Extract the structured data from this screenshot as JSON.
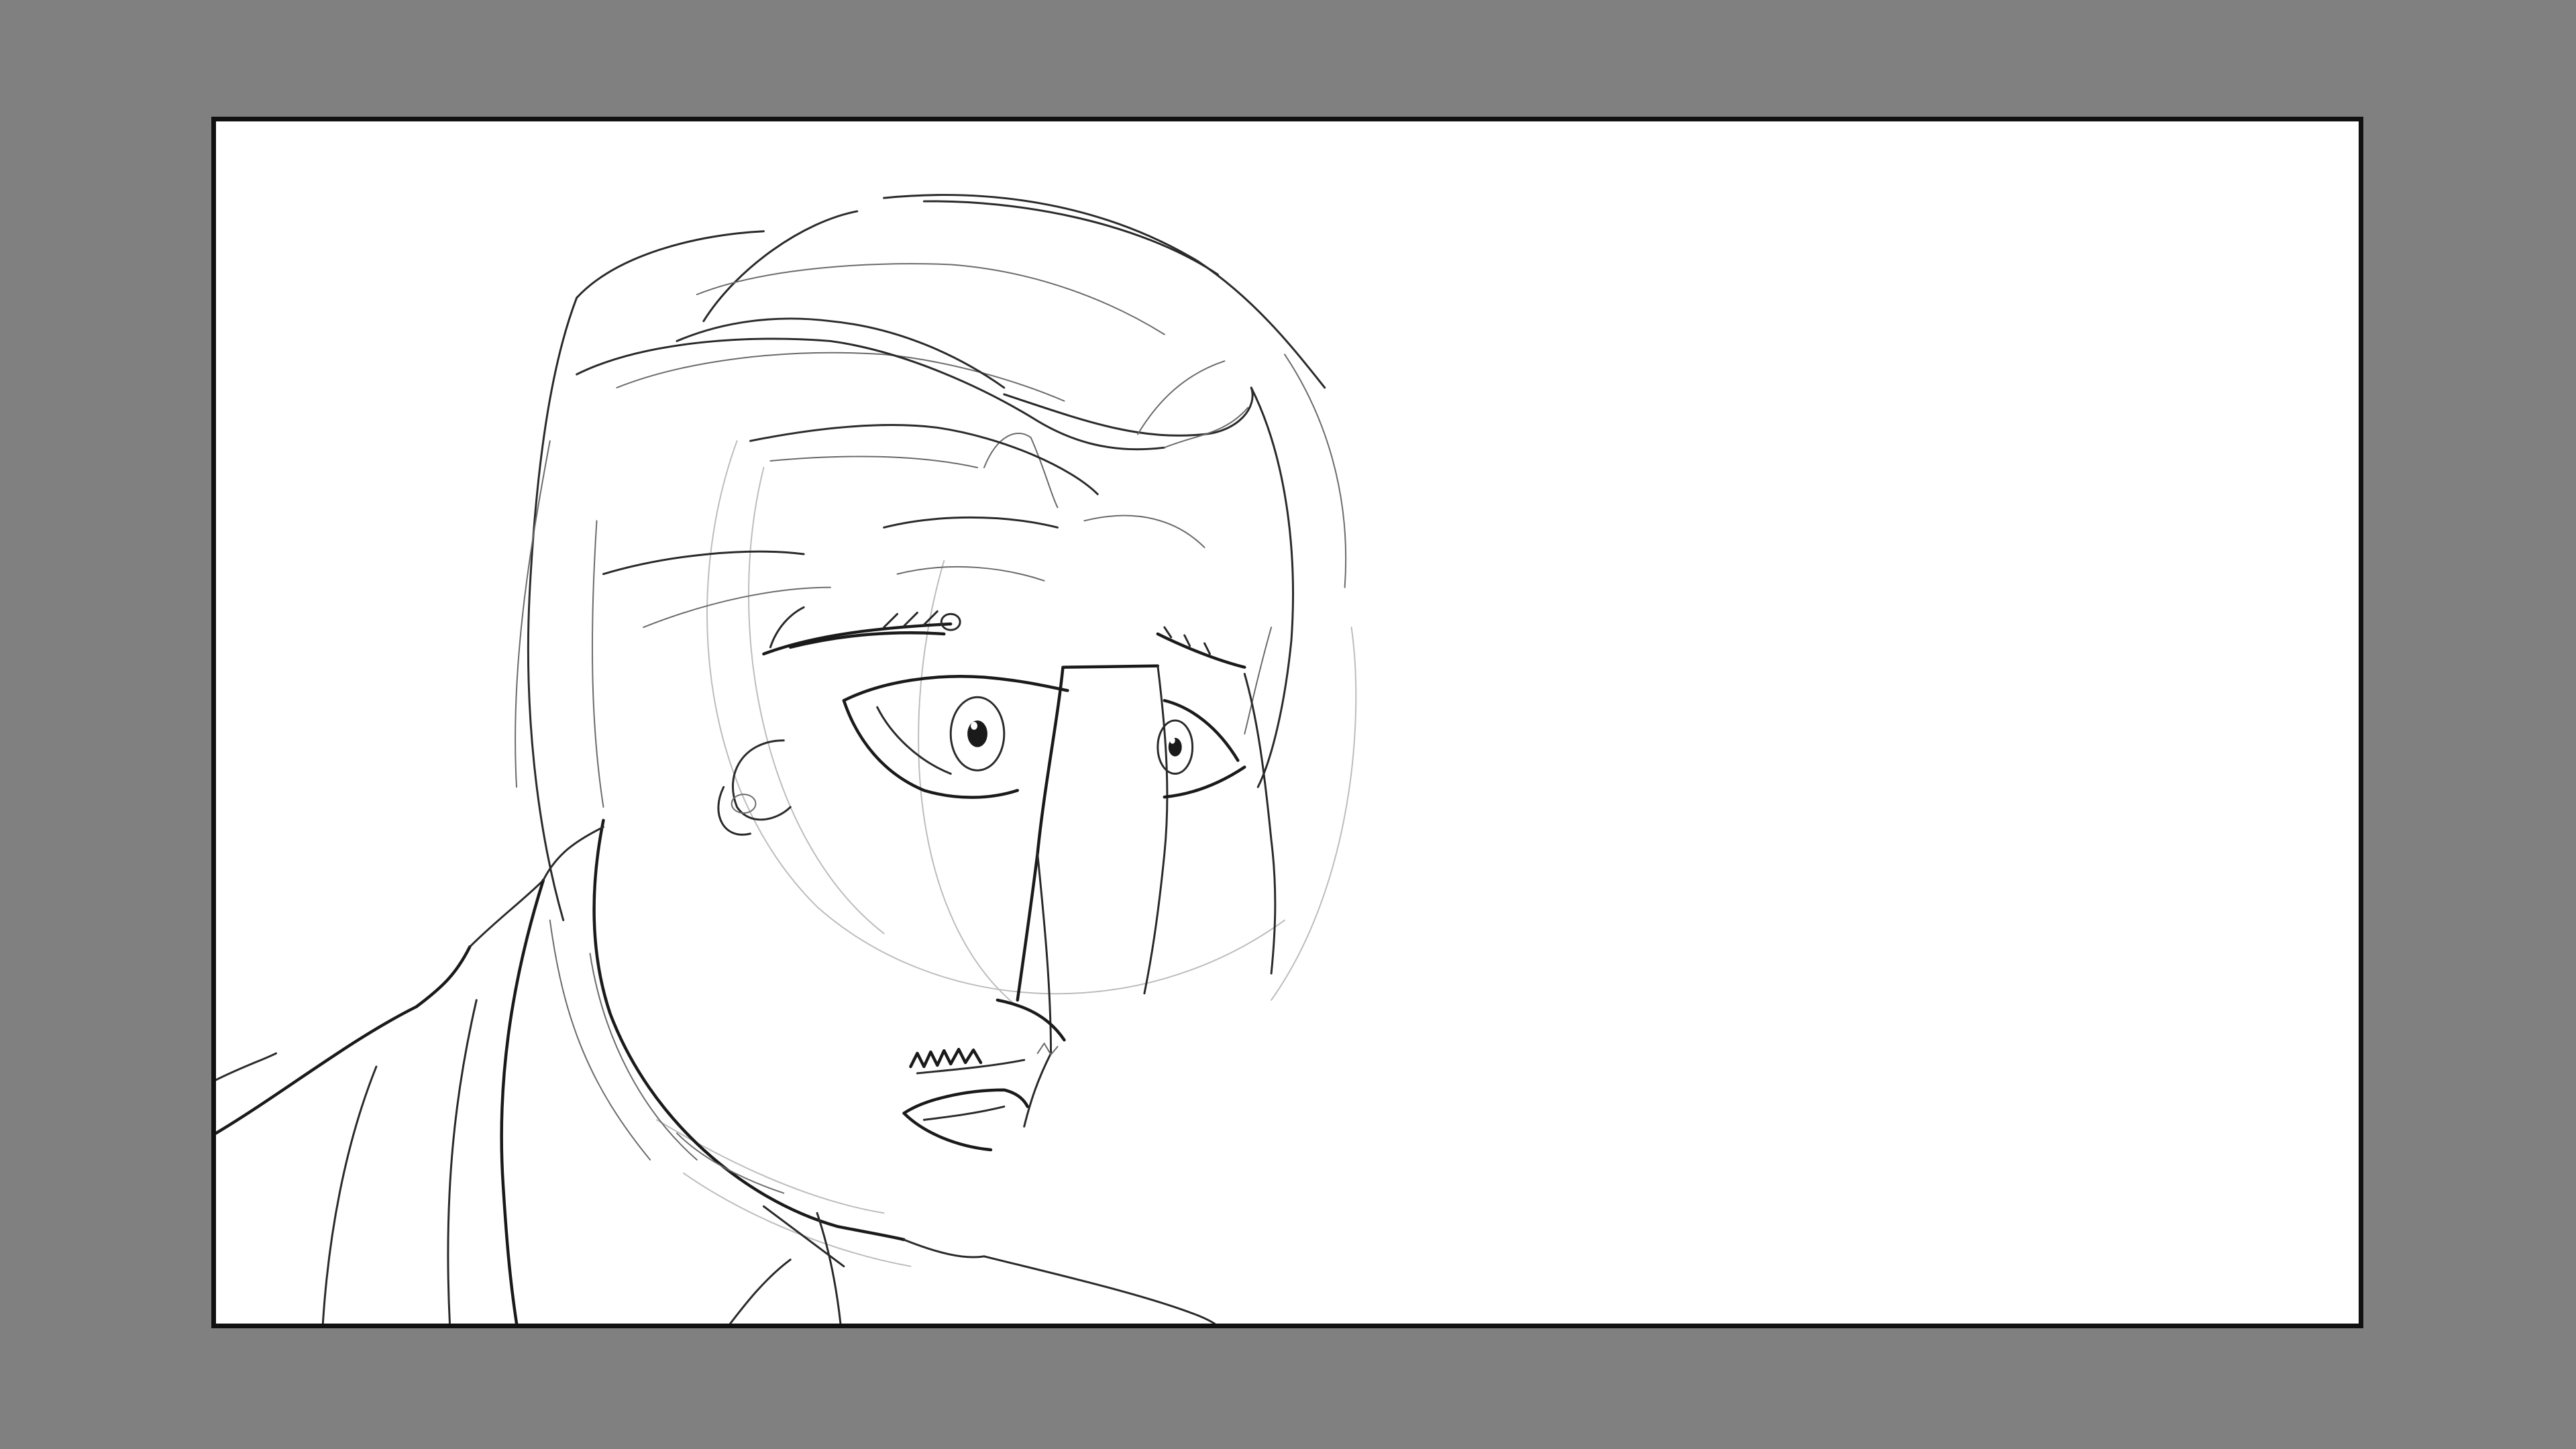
{
  "canvas": {
    "background_color": "#808080",
    "panel_color": "#ffffff",
    "border_color": "#111111"
  },
  "sketch": {
    "subject": "pencil-sketch-man-face",
    "line_color": "#1a1a1a"
  }
}
